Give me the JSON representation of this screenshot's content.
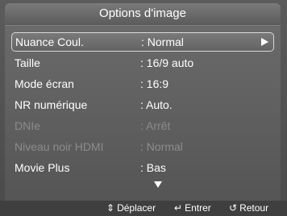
{
  "title": "Options d'image",
  "menu": {
    "items": [
      {
        "label": "Nuance Coul.",
        "value": ": Normal"
      },
      {
        "label": "Taille",
        "value": ": 16/9 auto"
      },
      {
        "label": "Mode écran",
        "value": ": 16:9"
      },
      {
        "label": "NR numérique",
        "value": ": Auto."
      },
      {
        "label": "DNIe",
        "value": ": Arrêt"
      },
      {
        "label": "Niveau noir HDMI",
        "value": ": Normal"
      },
      {
        "label": "Movie Plus",
        "value": ": Bas"
      }
    ]
  },
  "footer": {
    "move_label": "Déplacer",
    "enter_label": "Entrer",
    "return_label": "Retour",
    "move_icon": "updown-icon",
    "enter_icon": "enter-icon",
    "return_icon": "return-icon"
  },
  "colors": {
    "text": "#ffffff",
    "disabled_text": "#8c8c8c",
    "background": "#555555"
  }
}
